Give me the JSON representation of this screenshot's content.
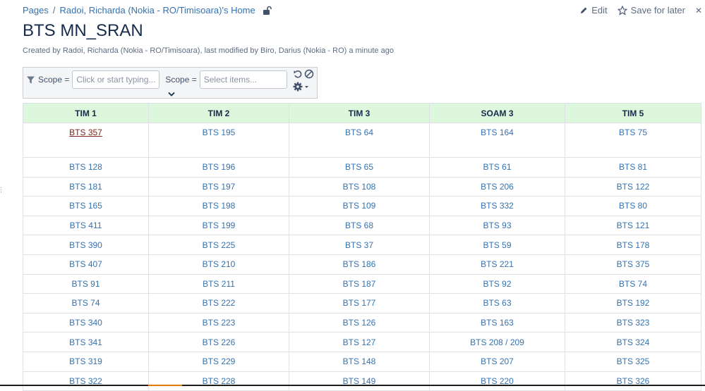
{
  "breadcrumb": {
    "root": "Pages",
    "separator": "/",
    "parent": "Radoi, Richarda (Nokia - RO/Timisoara)'s Home"
  },
  "actions": {
    "edit": "Edit",
    "save_for_later": "Save for later"
  },
  "page": {
    "title": "BTS MN_SRAN",
    "byline": "Created by Radoi, Richarda (Nokia - RO/Timisoara), last modified by Biro, Darius (Nokia - RO) a minute ago"
  },
  "filter": {
    "scope1_label": "Scope =",
    "scope1_placeholder": "Click or start typing...",
    "scope2_label": "Scope =",
    "scope2_placeholder": "Select items..."
  },
  "table": {
    "headers": [
      "TIM 1",
      "TIM 2",
      "TIM 3",
      "SOAM 3",
      "TIM 5"
    ],
    "rows": [
      [
        "BTS 357",
        "BTS 195",
        "BTS 64",
        "BTS 164",
        "BTS 75"
      ],
      [
        "BTS 128",
        "BTS 196",
        "BTS 65",
        "BTS 61",
        "BTS 81"
      ],
      [
        "BTS 181",
        "BTS 197",
        "BTS 108",
        "BTS 206",
        "BTS 122"
      ],
      [
        "BTS 165",
        "BTS 198",
        "BTS 109",
        "BTS 332",
        "BTS 80"
      ],
      [
        "BTS 411",
        "BTS 199",
        "BTS 68",
        "BTS 93",
        "BTS 121"
      ],
      [
        "BTS 390",
        "BTS 225",
        "BTS 37",
        "BTS 59",
        "BTS 178"
      ],
      [
        "BTS 407",
        "BTS 210",
        "BTS 186",
        "BTS 221",
        "BTS 375"
      ],
      [
        "BTS 91",
        "BTS 211",
        "BTS 187",
        "BTS 92",
        "BTS 74"
      ],
      [
        "BTS 74",
        "BTS 222",
        "BTS 177",
        "BTS 63",
        "BTS 192"
      ],
      [
        "BTS 340",
        "BTS 223",
        "BTS 126",
        "BTS 163",
        "BTS 323"
      ],
      [
        "BTS 341",
        "BTS 226",
        "BTS 127",
        "BTS 208 / 209",
        "BTS 324"
      ],
      [
        "BTS 319",
        "BTS 229",
        "BTS 148",
        "BTS 207",
        "BTS 325"
      ],
      [
        "BTS 322",
        "BTS 228",
        "BTS 149",
        "BTS 220",
        "BTS 326"
      ]
    ]
  },
  "icons": {
    "lock": "unlock-icon",
    "edit": "pencil-icon",
    "save": "star-icon",
    "filter": "funnel-icon",
    "reset": "undo-icon",
    "clear": "block-icon",
    "settings": "gear-icon",
    "collapse": "chevron-down-icon",
    "close": "close-icon"
  },
  "colors": {
    "link": "#3572b0",
    "visited_link": "#7a2518",
    "header_bg": "#dcf7dc",
    "text": "#172b4d",
    "muted": "#5e6c84"
  }
}
